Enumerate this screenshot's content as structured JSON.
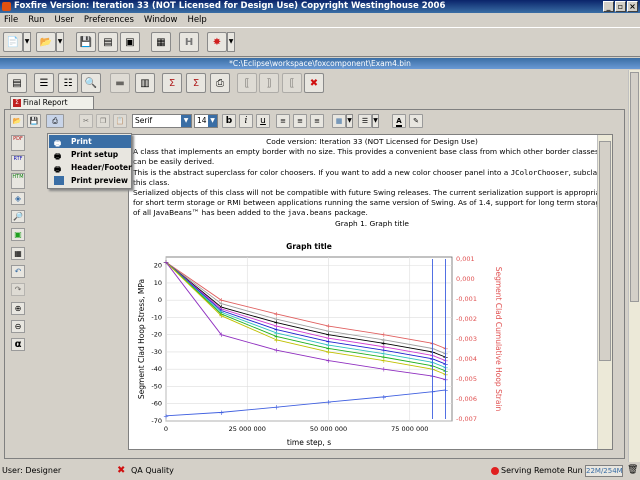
{
  "window": {
    "title": "Foxfire Version: Iteration 33 (NOT Licensed for Design Use)    Copyright Westinghouse 2006",
    "minimize": "_",
    "restore": "▫",
    "close": "×"
  },
  "menubar": [
    "File",
    "Run",
    "User",
    "Preferences",
    "Window",
    "Help"
  ],
  "document": {
    "path": "*C:\\Eclipse\\workspace\\foxcomponent\\Exam4.bin",
    "tab_label": "Final Report Template"
  },
  "format_toolbar": {
    "font": "Serif",
    "size": "14",
    "bold": "b",
    "italic": "i",
    "underline": "u"
  },
  "context_menu": {
    "items": [
      "Print",
      "Print setup",
      "Header/Footer",
      "Print preview"
    ],
    "selected": "Print"
  },
  "left_toolbar": {
    "pdf": "PDF",
    "rtf": "RTF",
    "htm": "HTM",
    "alpha": "α"
  },
  "report": {
    "header": "Code version: Iteration 33 (NOT Licensed for Design Use)",
    "p1": "A class that implements an empty border with no size. This provides a convenient base class from which other border classes can be easily derived.",
    "p2a": "This is the abstract superclass for color choosers. If you want to add a new color chooser panel into a",
    "p2code": "JColorChooser",
    "p2b": ", subclass this class.",
    "p3a": "Serialized objects of this class will not be compatible with future Swing releases. The current serialization support is appropriate for short term storage or RMI between applications running the same version of Swing. As of 1.4, support for long term storage of all JavaBeans™ has been added to the",
    "p3code": "java.beans",
    "p3b": "package.",
    "caption": "Graph 1. Graph title"
  },
  "status": {
    "user": "User: Designer",
    "qa": "QA Quality",
    "serving": "Serving Remote Run",
    "memory": "22M/254M"
  },
  "chart_data": {
    "type": "line",
    "title": "Graph title",
    "xlabel": "time step, s",
    "ylabel": "Segment Clad Hoop Stress, MPa",
    "y2label": "Segment Clad Cumulative Hoop Strain",
    "xlim": [
      0,
      88000000
    ],
    "ylim": [
      -70,
      25
    ],
    "y2lim": [
      -0.0071,
      0.0011
    ],
    "xticks": [
      "0",
      "25 000 000",
      "50 000 000",
      "75 000 000"
    ],
    "xtick_values": [
      0,
      25000000,
      50000000,
      75000000
    ],
    "yticks": [
      "20",
      "10",
      "0",
      "-10",
      "-20",
      "-30",
      "-40",
      "-50",
      "-60",
      "-70"
    ],
    "ytick_values": [
      20,
      10,
      0,
      -10,
      -20,
      -30,
      -40,
      -50,
      -60,
      -70
    ],
    "y2ticks": [
      "0,001",
      "0,000",
      "-0,001",
      "-0,002",
      "-0,003",
      "-0,004",
      "-0,005",
      "-0,006",
      "-0,007"
    ],
    "y2tick_values": [
      0.001,
      0.0,
      -0.001,
      -0.002,
      -0.003,
      -0.004,
      -0.005,
      -0.006,
      -0.007
    ],
    "grid": true,
    "x": [
      0,
      17000000,
      34000000,
      50000000,
      67000000,
      82000000,
      86000000
    ],
    "series": [
      {
        "color": "#e06060",
        "values": [
          22,
          0,
          -8,
          -15,
          -20,
          -25,
          -28
        ]
      },
      {
        "color": "#a0a0a0",
        "values": [
          22,
          -2,
          -11,
          -18,
          -23,
          -28,
          -31
        ]
      },
      {
        "color": "#000000",
        "values": [
          22,
          -4,
          -13,
          -20,
          -25,
          -30,
          -33
        ]
      },
      {
        "color": "#d040d0",
        "values": [
          22,
          -5,
          -15,
          -22,
          -27,
          -32,
          -35
        ]
      },
      {
        "color": "#2020d0",
        "values": [
          22,
          -6,
          -17,
          -24,
          -29,
          -34,
          -37
        ]
      },
      {
        "color": "#30c0c0",
        "values": [
          22,
          -7,
          -19,
          -26,
          -31,
          -36,
          -39
        ]
      },
      {
        "color": "#20b020",
        "values": [
          22,
          -8,
          -21,
          -28,
          -33,
          -38,
          -41
        ]
      },
      {
        "color": "#c0c000",
        "values": [
          22,
          -9,
          -23,
          -30,
          -35,
          -40,
          -43
        ]
      },
      {
        "color": "#9030c0",
        "values": [
          22,
          -20,
          -29,
          -35,
          -40,
          -44,
          -46
        ]
      },
      {
        "color": "#4060e0",
        "values": [
          -67,
          -65,
          -62,
          -59,
          -56,
          -53,
          -52
        ]
      }
    ]
  }
}
